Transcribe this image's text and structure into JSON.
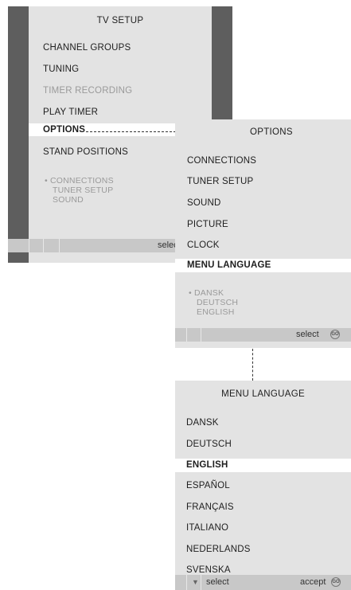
{
  "tv_setup": {
    "title": "TV SETUP",
    "items": [
      "CHANNEL GROUPS",
      "TUNING",
      "TIMER RECORDING",
      "PLAY TIMER",
      "OPTIONS",
      "STAND POSITIONS"
    ],
    "sub_items": [
      "• CONNECTIONS",
      "TUNER SETUP",
      "SOUND"
    ],
    "footer_select": "select"
  },
  "options": {
    "title": "OPTIONS",
    "items": [
      "CONNECTIONS",
      "TUNER SETUP",
      "SOUND",
      "PICTURE",
      "CLOCK",
      "MENU LANGUAGE"
    ],
    "sub_items": [
      "• DANSK",
      "DEUTSCH",
      "ENGLISH"
    ],
    "footer_select": "select",
    "footer_icon": "GO"
  },
  "menu_language": {
    "title": "MENU LANGUAGE",
    "items": [
      "DANSK",
      "DEUTSCH",
      "ENGLISH",
      "ESPAÑOL",
      "FRANÇAIS",
      "ITALIANO",
      "NEDERLANDS",
      "SVENSKA"
    ],
    "footer_arrow": "▼",
    "footer_select": "select",
    "footer_accept": "accept",
    "footer_icon": "GO"
  },
  "colors": {
    "panel": "#e3e3e3",
    "sidebar": "#5e5e5e",
    "footer": "#c8c8c8",
    "highlight": "#ffffff",
    "dim_text": "#9a9a9a"
  }
}
